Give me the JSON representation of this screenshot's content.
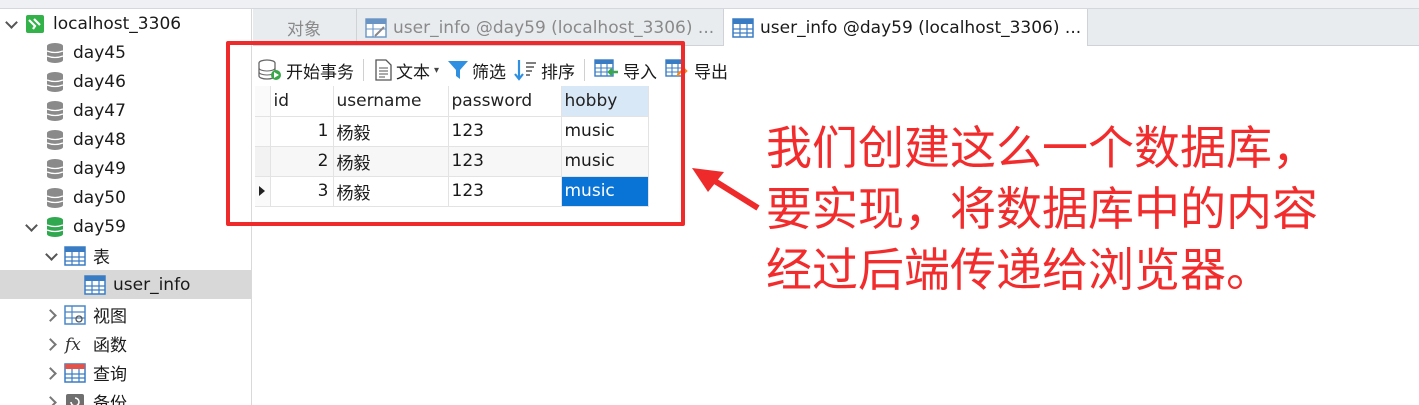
{
  "sidebar": {
    "connection": "localhost_3306",
    "databases": [
      "day45",
      "day46",
      "day47",
      "day48",
      "day49",
      "day50"
    ],
    "open_database": "day59",
    "tables_group": "表",
    "selected_table": "user_info",
    "other_groups": [
      "视图",
      "函数",
      "查询",
      "备份"
    ]
  },
  "tabs": [
    {
      "label": "对象"
    },
    {
      "label": "user_info @day59 (localhost_3306) ..."
    },
    {
      "label": "user_info @day59 (localhost_3306) ..."
    }
  ],
  "toolbar": {
    "begin_transaction": "开始事务",
    "text": "文本",
    "filter": "筛选",
    "sort": "排序",
    "import": "导入",
    "export": "导出"
  },
  "grid": {
    "columns": [
      "id",
      "username",
      "password",
      "hobby"
    ],
    "rows": [
      [
        "1",
        "杨毅",
        "123",
        "music"
      ],
      [
        "2",
        "杨毅",
        "123",
        "music"
      ],
      [
        "3",
        "杨毅",
        "123",
        "music"
      ]
    ]
  },
  "annotation": {
    "lines": [
      "我们创建这么一个数据库，",
      "要实现，将数据库中的内容",
      "经过后端传递给浏览器。"
    ],
    "color": "#f22c2c"
  }
}
